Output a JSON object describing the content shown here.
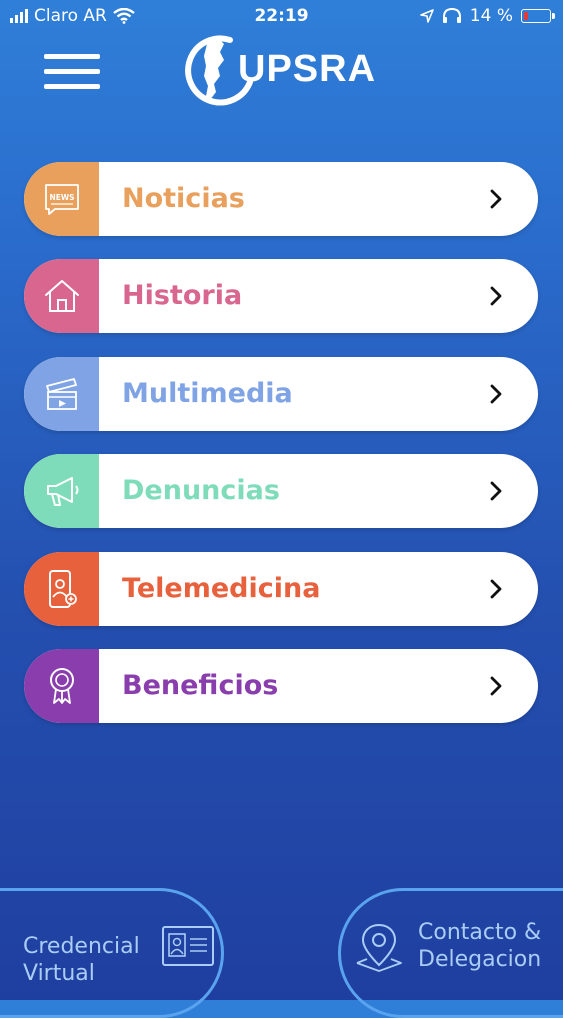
{
  "status_bar": {
    "carrier": "Claro AR",
    "time": "22:19",
    "battery_percent": "14 %",
    "battery_level": 0.14,
    "battery_color": "#e53935"
  },
  "header": {
    "logo_text": "UPSRA",
    "menu_icon": "hamburger-menu-icon"
  },
  "menu": [
    {
      "label": "Noticias",
      "icon": "news-icon",
      "color": "#e8a05c"
    },
    {
      "label": "Historia",
      "icon": "home-icon",
      "color": "#d9668e"
    },
    {
      "label": "Multimedia",
      "icon": "clapperboard-icon",
      "color": "#7fa3e4"
    },
    {
      "label": "Denuncias",
      "icon": "megaphone-icon",
      "color": "#7fdcbb"
    },
    {
      "label": "Telemedicina",
      "icon": "phone-doctor-icon",
      "color": "#e8613d"
    },
    {
      "label": "Beneficios",
      "icon": "award-ribbon-icon",
      "color": "#8a3eae"
    }
  ],
  "news_icon_text": "NEWS",
  "bottom": {
    "credencial_line1": "Credencial",
    "credencial_line2": "Virtual",
    "contacto_line1": "Contacto &",
    "contacto_line2": "Delegacion"
  }
}
